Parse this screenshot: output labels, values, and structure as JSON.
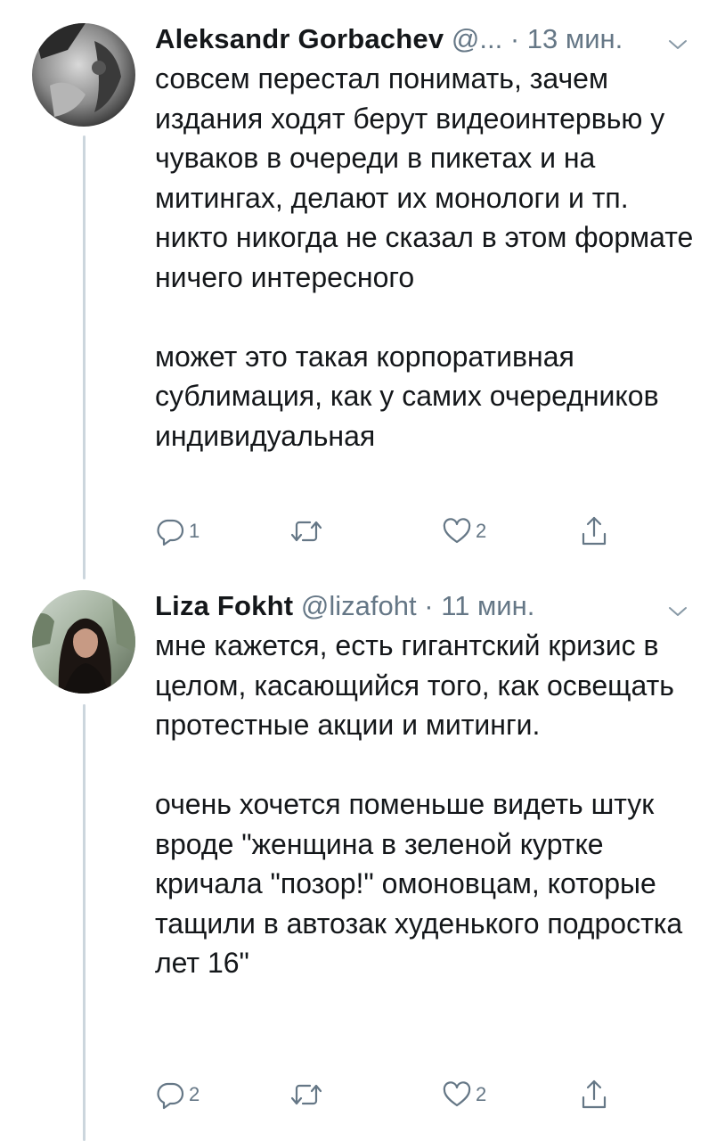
{
  "tweets": [
    {
      "display_name": "Aleksandr Gorbachev",
      "handle": "@...",
      "separator": "·",
      "time": "13 мин.",
      "paragraphs": [
        "совсем перестал понимать, зачем издания ходят берут видеоинтервью у чуваков в очереди в пикетах и на митингах, делают их монологи и тп. никто никогда не сказал в этом формате ничего интересного",
        "может это такая корпоративная сублимация, как у самих очередников индивидуальная"
      ],
      "reply_count": "1",
      "retweet_count": "",
      "like_count": "2",
      "avatar_icon": "user-avatar-grayscale-photo"
    },
    {
      "display_name": "Liza Fokht",
      "handle": "@lizafoht",
      "separator": "·",
      "time": "11 мин.",
      "paragraphs": [
        "мне кажется, есть гигантский кризис в целом, касающийся того, как освещать протестные акции и митинги.",
        "очень хочется поменьше видеть штук вроде \"женщина в зеленой куртке кричала \"позор!\" омоновцам, которые тащили в автозак худенького подростка лет 16\""
      ],
      "reply_count": "2",
      "retweet_count": "",
      "like_count": "2",
      "avatar_icon": "user-avatar-photo"
    }
  ],
  "icons": {
    "reply": "reply-icon",
    "retweet": "retweet-icon",
    "like": "heart-icon",
    "share": "share-icon",
    "more": "chevron-down-icon"
  },
  "colors": {
    "text": "#14171a",
    "secondary": "#657786",
    "thread_line": "#ccd6dd",
    "background": "#ffffff"
  }
}
